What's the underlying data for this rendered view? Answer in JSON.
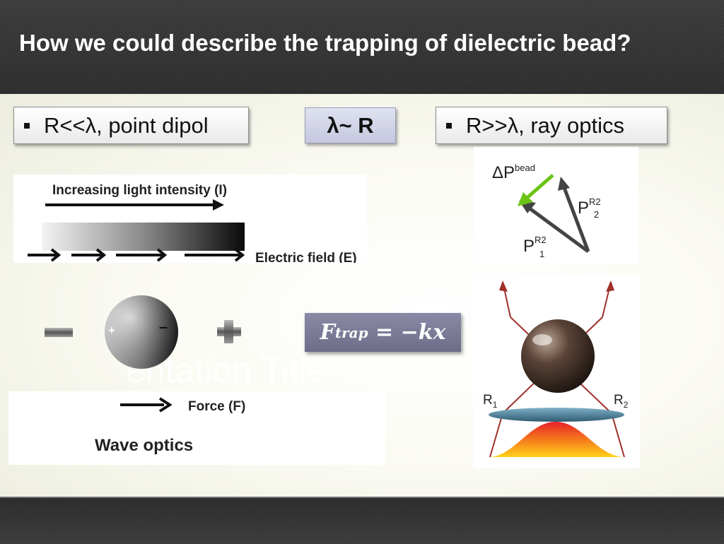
{
  "slide": {
    "title": "How we could describe the trapping of dielectric bead?",
    "ghost_placeholder": "entation Title"
  },
  "boxes": {
    "left_label": "R<<λ, point dipol",
    "middle_label": "λ~ R",
    "right_label": "R>>λ, ray optics"
  },
  "formula": {
    "main": "F",
    "subscript": "trap",
    "rest": " = −kx"
  },
  "wave_optics": {
    "intensity_label": "Increasing light intensity (I)",
    "field_label": "Electric field (E)",
    "minus_sign": "−",
    "plus_sign": "+",
    "bead_plus": "+",
    "bead_minus": "–",
    "force_label": "Force (F)",
    "caption": "Wave optics"
  },
  "ray_optics": {
    "delta_p": "ΔP",
    "delta_p_sup": "bead",
    "p2": "P",
    "p2_sup": "R2",
    "p2_sub": "2",
    "p1": "P",
    "p1_sup": "R2",
    "p1_sub": "1",
    "r1": "R",
    "r1_sub": "1",
    "r2": "R",
    "r2_sub": "2"
  },
  "colors": {
    "title_text": "#ffffff",
    "formula_bg": "#7b7b98",
    "green_arrow": "#6cc417",
    "ray_red": "#a0302a",
    "lens_blue": "#4a7f9a"
  }
}
